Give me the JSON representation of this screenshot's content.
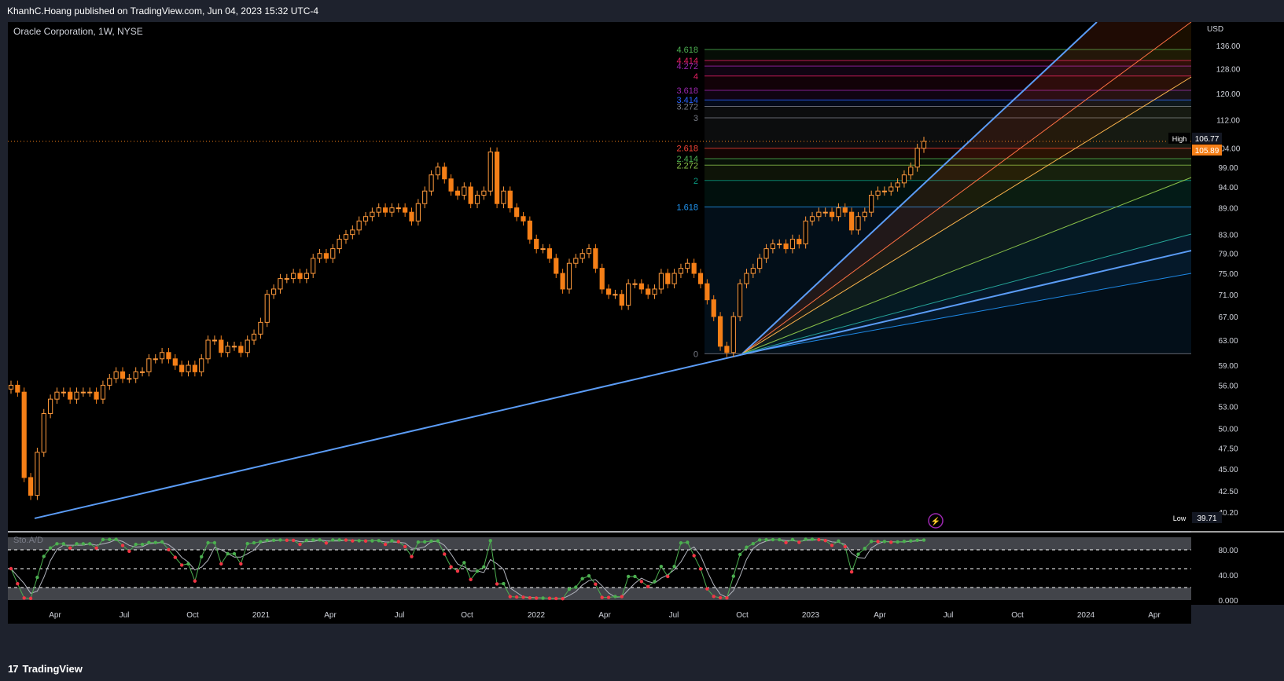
{
  "header": {
    "published": "KhanhC.Hoang published on TradingView.com, Jun 04, 2023 15:32 UTC-4"
  },
  "footer": {
    "brand": "TradingView"
  },
  "colors": {
    "bg": "#000000",
    "frame": "#1e222d",
    "up": "#ff9a3c",
    "down": "#f57f17",
    "trend": "#5b9cf6",
    "grid": "#2a2e39"
  },
  "chart_data": {
    "type": "candlestick",
    "title": "Oracle Corporation, 1W, NYSE",
    "currency": "USD",
    "y_axis_labels": [
      "136.00",
      "128.00",
      "120.00",
      "112.00",
      "106.77",
      "105.89",
      "104.00",
      "99.00",
      "94.00",
      "89.00",
      "83.00",
      "79.00",
      "75.00",
      "71.00",
      "67.00",
      "63.00",
      "59.00",
      "56.00",
      "53.00",
      "50.00",
      "47.50",
      "45.00",
      "42.50",
      "40.20",
      "39.71"
    ],
    "price_ticks": [
      136,
      128,
      120,
      112,
      104,
      99,
      94,
      89,
      83,
      79,
      75,
      71,
      67,
      63,
      59,
      56,
      53,
      50,
      47.5,
      45,
      42.5,
      40.2
    ],
    "last_price": "105.89",
    "high": {
      "label": "High",
      "value": "106.77"
    },
    "low": {
      "label": "Low",
      "value": "39.71"
    },
    "x_axis_labels": [
      "Apr",
      "Jul",
      "Oct",
      "2021",
      "Apr",
      "Jul",
      "Oct",
      "2022",
      "Apr",
      "Jul",
      "Oct",
      "2023",
      "Apr",
      "Jul",
      "Oct",
      "2024",
      "Apr"
    ],
    "fib_levels": [
      {
        "label": "4.618",
        "color": "#4caf50"
      },
      {
        "label": "4.414",
        "color": "#e91e63"
      },
      {
        "label": "4.272",
        "color": "#9c27b0"
      },
      {
        "label": "4",
        "color": "#e91e63"
      },
      {
        "label": "3.618",
        "color": "#9c27b0"
      },
      {
        "label": "3.414",
        "color": "#2962ff"
      },
      {
        "label": "3.272",
        "color": "#787b86"
      },
      {
        "label": "3",
        "color": "#787b86"
      },
      {
        "label": "2.618",
        "color": "#f44336"
      },
      {
        "label": "2.414",
        "color": "#4caf50"
      },
      {
        "label": "2.272",
        "color": "#8bc34a"
      },
      {
        "label": "2",
        "color": "#089981"
      },
      {
        "label": "1.618",
        "color": "#2196f3"
      },
      {
        "label": "0",
        "color": "#787b86"
      }
    ],
    "anchor_points": [
      {
        "x": "2020-03",
        "y": 39.71
      },
      {
        "x": "2022-10",
        "y": 60.8
      },
      {
        "x": "2023-06",
        "y": 106.77
      }
    ],
    "closes": [
      56,
      55,
      44,
      42,
      47,
      52,
      54,
      55,
      55,
      54,
      55,
      55,
      55,
      54,
      56,
      57,
      58,
      57,
      57,
      58,
      58,
      60,
      60,
      61,
      60,
      59,
      58,
      59,
      58,
      60,
      63,
      63,
      61,
      62,
      62,
      61,
      63,
      64,
      66,
      71,
      72,
      74,
      74,
      75,
      74,
      75,
      78,
      79,
      78,
      80,
      82,
      83,
      84,
      86,
      87,
      88,
      89,
      88,
      89,
      89,
      88,
      86,
      90,
      93,
      97,
      99,
      96,
      93,
      92,
      94,
      90,
      92,
      93,
      103,
      90,
      93,
      89,
      87,
      86,
      82,
      80,
      80,
      78,
      75,
      72,
      77,
      78,
      79,
      80,
      76,
      72,
      71,
      71,
      69,
      73,
      73,
      72,
      71,
      72,
      75,
      73,
      75,
      76,
      77,
      75,
      73,
      70,
      67,
      62,
      61,
      67,
      73,
      75,
      76,
      78,
      80,
      81,
      81,
      80,
      82,
      81,
      86,
      87,
      88,
      88,
      87,
      89,
      88,
      84,
      87,
      88,
      92,
      93,
      93,
      94,
      95,
      97,
      99,
      104,
      105.89
    ]
  },
  "indicator": {
    "name": "Sto.A/D",
    "axis_labels": [
      "80.00",
      "40.00",
      "0.000"
    ],
    "ticks": [
      80,
      40,
      0
    ]
  }
}
